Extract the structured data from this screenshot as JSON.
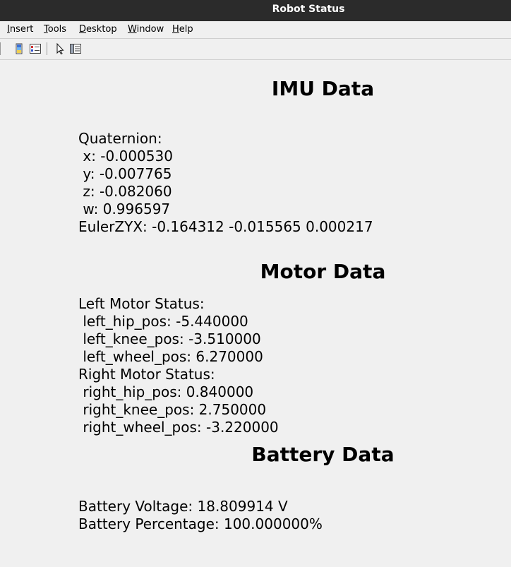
{
  "window": {
    "title": "Robot Status"
  },
  "menu": {
    "items": [
      {
        "label": "Insert",
        "accel": "I"
      },
      {
        "label": "Tools",
        "accel": "T"
      },
      {
        "label": "Desktop",
        "accel": "D"
      },
      {
        "label": "Window",
        "accel": "W"
      },
      {
        "label": "Help",
        "accel": "H"
      }
    ]
  },
  "toolbar": {
    "buttons": [
      "insert-colorbar-icon",
      "insert-legend-icon",
      "edit-plot-arrow-icon",
      "property-inspector-icon"
    ]
  },
  "imu": {
    "heading": "IMU Data",
    "quaternion_label": "Quaternion:",
    "x": " x: -0.000530",
    "y": " y: -0.007765",
    "z": " z: -0.082060",
    "w": " w: 0.996597",
    "euler": "EulerZYX: -0.164312 -0.015565 0.000217"
  },
  "motor": {
    "heading": "Motor Data",
    "left_label": "Left Motor Status:",
    "left_hip": " left_hip_pos: -5.440000",
    "left_knee": " left_knee_pos: -3.510000",
    "left_wheel": " left_wheel_pos: 6.270000",
    "right_label": "Right Motor Status:",
    "right_hip": " right_hip_pos: 0.840000",
    "right_knee": " right_knee_pos: 2.750000",
    "right_wheel": " right_wheel_pos: -3.220000"
  },
  "battery": {
    "heading": "Battery Data",
    "voltage": "Battery Voltage: 18.809914 V",
    "percentage": "Battery Percentage: 100.000000%"
  }
}
